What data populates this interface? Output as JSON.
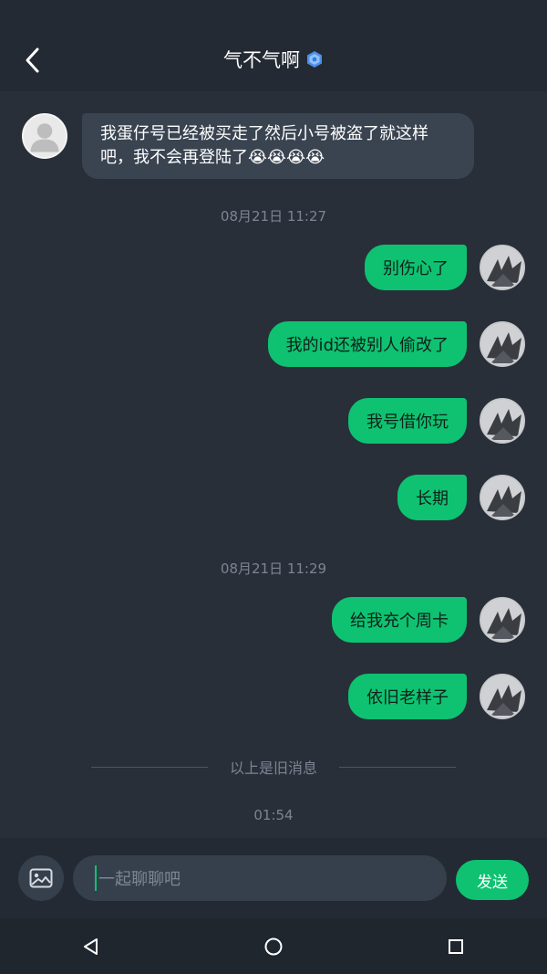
{
  "header": {
    "title": "气不气啊",
    "back_icon": "chevron-left-icon",
    "verified_icon": "verified-badge-icon"
  },
  "messages": [
    {
      "direction": "in",
      "text": "我蛋仔号已经被买走了然后小号被盗了就这样吧，我不会再登陆了😭😭😭😭"
    },
    {
      "type": "timestamp",
      "text": "08月21日 11:27"
    },
    {
      "direction": "out",
      "text": "别伤心了"
    },
    {
      "direction": "out",
      "text": "我的id还被别人偷改了"
    },
    {
      "direction": "out",
      "text": "我号借你玩"
    },
    {
      "direction": "out",
      "text": "长期"
    },
    {
      "type": "timestamp",
      "text": "08月21日 11:29"
    },
    {
      "direction": "out",
      "text": "给我充个周卡"
    },
    {
      "direction": "out",
      "text": "依旧老样子"
    }
  ],
  "divider": {
    "text": "以上是旧消息"
  },
  "latest_time": "01:54",
  "composer": {
    "image_icon": "image-icon",
    "placeholder": "一起聊聊吧",
    "send_label": "发送"
  },
  "navbar": {
    "back_icon": "triangle-back-icon",
    "home_icon": "circle-home-icon",
    "recents_icon": "square-recents-icon"
  },
  "colors": {
    "background": "#282f39",
    "header": "#232a33",
    "incoming_bubble": "#3a4451",
    "outgoing_bubble": "#0ec271",
    "timestamp": "#7b8592"
  }
}
